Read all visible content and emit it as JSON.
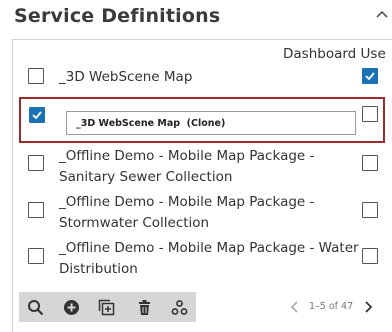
{
  "header": {
    "title": "Service Definitions",
    "collapse_icon": "chevron-up-icon"
  },
  "table": {
    "column_header": "Dashboard Use",
    "rows": [
      {
        "label": "_3D WebScene Map",
        "selected": false,
        "dashboard_use": true
      },
      {
        "label": "",
        "selected": true,
        "dashboard_use": false,
        "editing": true,
        "input_value": "_3D WebScene Map  (Clone)"
      },
      {
        "label_line1": "_Offline Demo - Mobile Map Package -",
        "label_line2": "Sanitary Sewer Collection",
        "selected": false,
        "dashboard_use": false
      },
      {
        "label_line1": "_Offline Demo - Mobile Map Package -",
        "label_line2": "Stormwater Collection",
        "selected": false,
        "dashboard_use": false
      },
      {
        "label_line1": "_Offline Demo - Mobile Map Package - Water",
        "label_line2": "Distribution",
        "selected": false,
        "dashboard_use": false
      }
    ]
  },
  "toolbar": {
    "icons": [
      "search-icon",
      "add-icon",
      "clone-icon",
      "delete-icon",
      "settings-icon"
    ]
  },
  "pager": {
    "text": "1–5 of 47",
    "prev_icon": "chevron-left-icon",
    "next_icon": "chevron-right-icon"
  },
  "colors": {
    "accent": "#1a72b5",
    "selection_border": "#9e2b2b",
    "toolbar_bg": "#d6d6d6"
  }
}
